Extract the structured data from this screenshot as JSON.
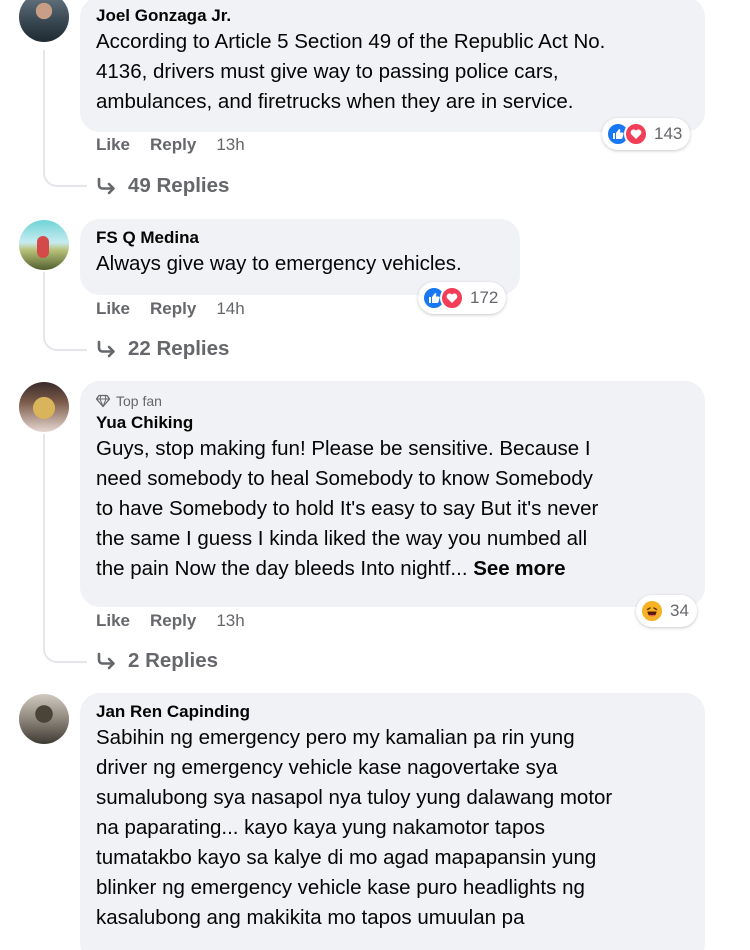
{
  "comments": [
    {
      "author": "Joel Gonzaga Jr.",
      "lines": [
        "According to Article 5 Section 49 of the Republic Act No.",
        "4136, drivers must give way to passing police cars,",
        "ambulances, and firetrucks when they are in service."
      ],
      "like_label": "Like",
      "reply_label": "Reply",
      "time": "13h",
      "reaction_count": "143",
      "reactions": [
        "like-icon",
        "love-icon"
      ],
      "replies_label": "49 Replies"
    },
    {
      "author": "FS Q Medina",
      "lines": [
        "Always give way to emergency vehicles."
      ],
      "like_label": "Like",
      "reply_label": "Reply",
      "time": "14h",
      "reaction_count": "172",
      "reactions": [
        "like-icon",
        "love-icon"
      ],
      "replies_label": "22 Replies"
    },
    {
      "badge": "Top fan",
      "author": "Yua Chiking",
      "lines": [
        "Guys, stop making fun! Please be sensitive. Because I",
        "need somebody to heal Somebody to know Somebody",
        "to have Somebody to hold It's easy to say But it's never",
        "the same I guess I kinda liked the way you numbed all",
        "the pain Now the day bleeds Into nightf... "
      ],
      "see_more": "See more",
      "like_label": "Like",
      "reply_label": "Reply",
      "time": "13h",
      "reaction_count": "34",
      "reactions": [
        "haha-icon"
      ],
      "replies_label": "2 Replies"
    },
    {
      "author": "Jan Ren Capinding",
      "lines": [
        "Sabihin ng emergency pero my kamalian pa rin yung",
        "driver ng emergency vehicle kase nagovertake sya",
        "sumalubong sya nasapol nya tuloy yung dalawang motor",
        "na paparating... kayo kaya yung nakamotor tapos",
        "tumatakbo kayo sa kalye di mo agad mapapansin yung",
        "blinker ng emergency vehicle kase puro headlights ng",
        "kasalubong ang makikita mo tapos umuulan pa"
      ]
    }
  ],
  "colors": {
    "bubble": "#f0f2f5",
    "secondary_text": "#65676b",
    "like_blue": "#1877f2",
    "love_red": "#f33e58",
    "haha_yellow": "#f7b125"
  }
}
